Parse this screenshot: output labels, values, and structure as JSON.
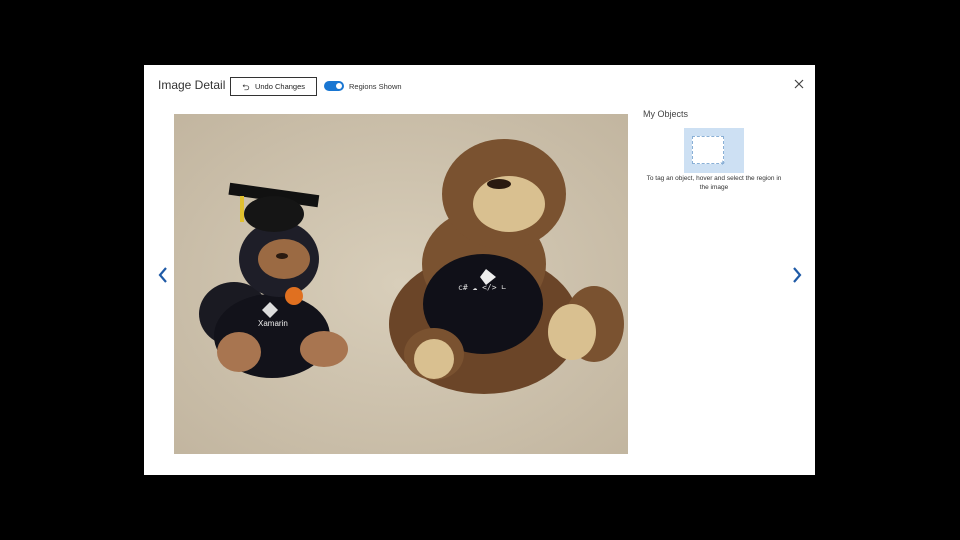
{
  "dialog": {
    "title": "Image Detail",
    "undo_label": "Undo Changes",
    "toggle": {
      "label": "Regions Shown",
      "on": true
    }
  },
  "photo": {
    "description_left": "black plush monkey with graduation cap",
    "description_right": "brown plush monkey with black shirt",
    "left_shirt_text": "Xamarin"
  },
  "sidebar": {
    "title": "My Objects",
    "help_text": "To tag an object, hover and select the region in the image"
  },
  "icons": {
    "undo": "undo-icon",
    "close": "close-icon",
    "prev": "chevron-left-icon",
    "next": "chevron-right-icon"
  },
  "colors": {
    "accent": "#1976d2",
    "placeholder": "#cde0f3"
  }
}
